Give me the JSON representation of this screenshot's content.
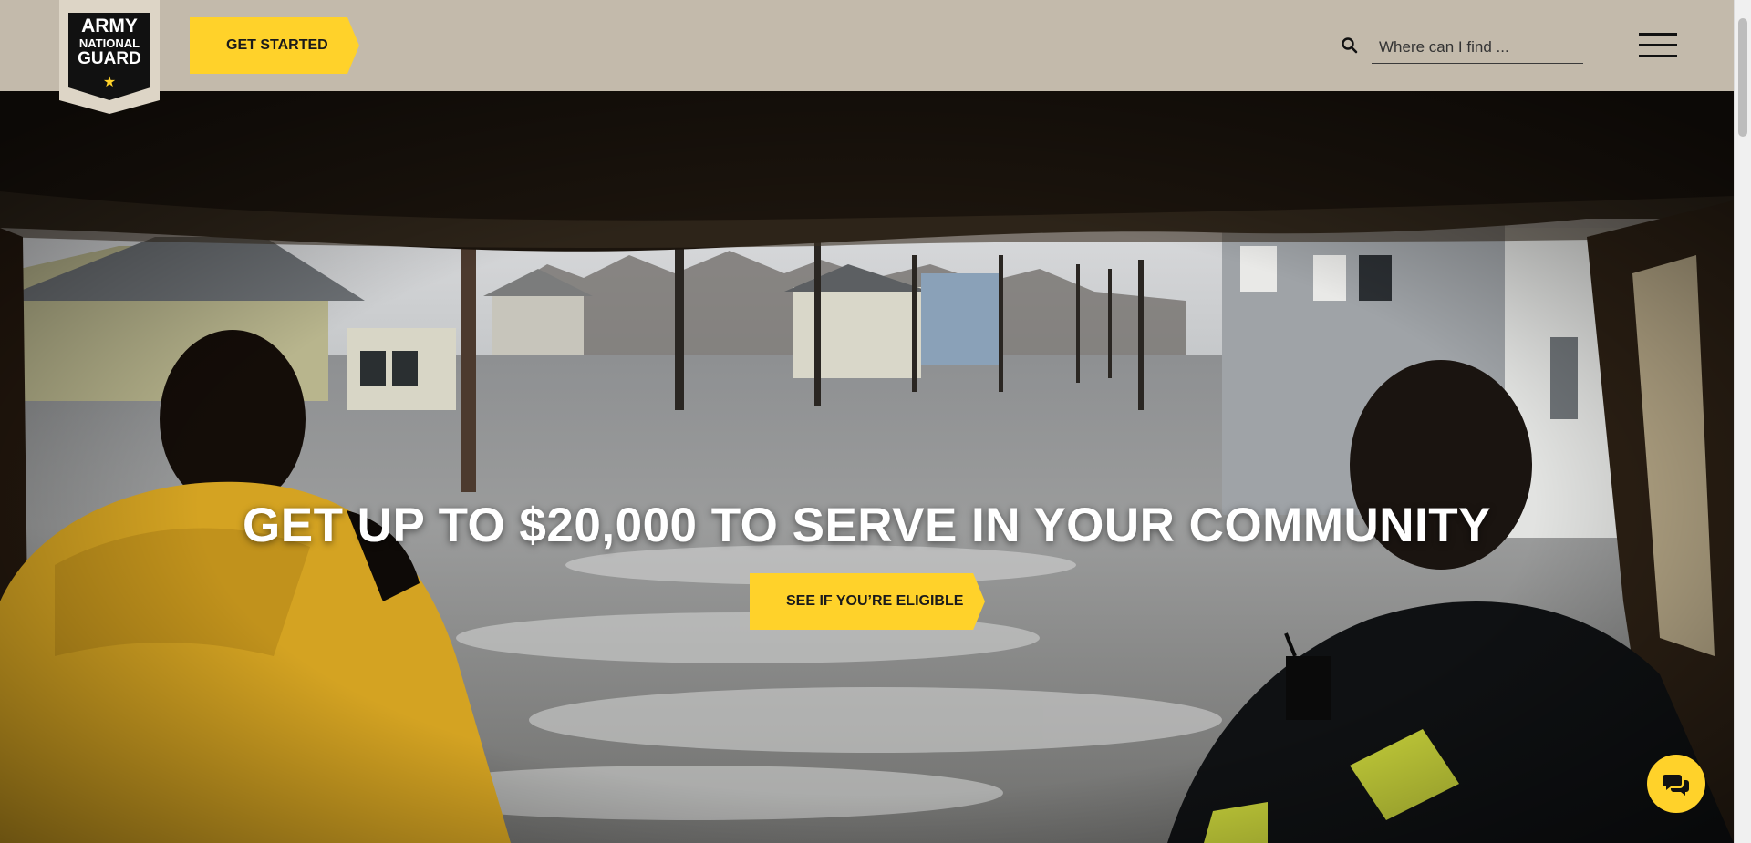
{
  "brand": {
    "logo_line1": "ARMY",
    "logo_line2": "NATIONAL",
    "logo_line3": "GUARD",
    "logo_star": "★"
  },
  "header": {
    "cta_label": "GET STARTED",
    "search_placeholder": "Where can I find ...",
    "search_icon": "search-icon",
    "menu_icon": "hamburger-menu-icon"
  },
  "hero": {
    "title": "GET UP TO $20,000 TO SERVE IN YOUR COMMUNITY",
    "cta_label": "SEE IF YOU’RE ELIGIBLE"
  },
  "chat": {
    "icon": "chat-bubbles-icon"
  },
  "colors": {
    "header_bg": "#c3baab",
    "accent_yellow": "#ffd22a",
    "logo_black": "#111111",
    "text_dark": "#1a1a1a"
  }
}
